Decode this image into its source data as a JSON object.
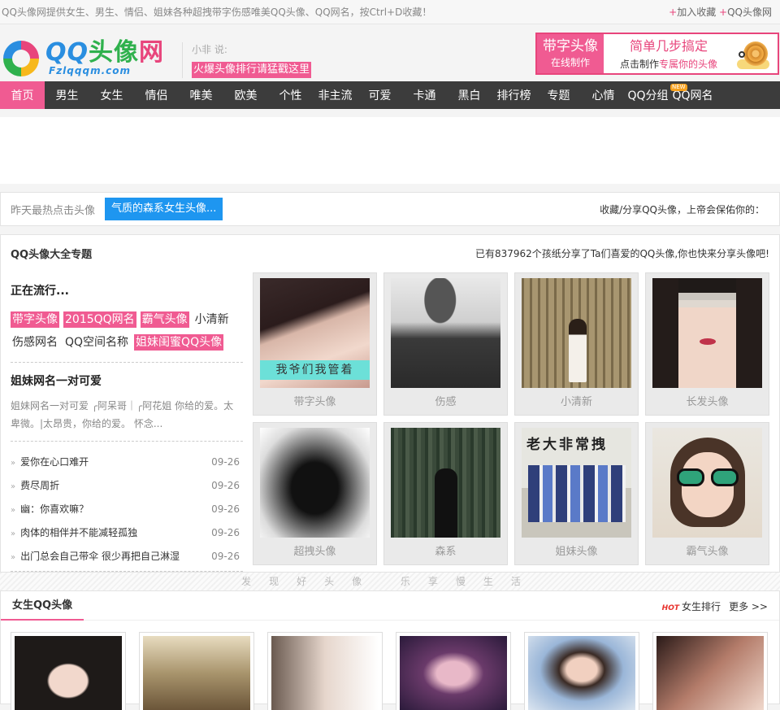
{
  "topbar": {
    "intro": "QQ头像网提供女生、男生、情侣、姐妹各种超拽带字伤感唯美QQ头像、QQ网名，按Ctrl+D收藏！",
    "plus1": "+",
    "fav": "加入收藏",
    "plus2": "+",
    "qqavatar": "QQ头像网"
  },
  "header": {
    "logo_part1": "QQ",
    "logo_part2": "头像",
    "logo_part3": "网",
    "logo_sub": "Fzlqqqm.com",
    "notice_who": "小非 说:",
    "notice_msg": "火爆头像排行请猛戳这里",
    "promo_l1": "带字头像",
    "promo_l2": "在线制作",
    "promo_r1": "简单几步搞定",
    "promo_r2a": "点击制作",
    "promo_r2b": "专属你的头像"
  },
  "nav": {
    "items": [
      "首页",
      "男生",
      "女生",
      "情侣",
      "唯美",
      "欧美",
      "个性",
      "非主流",
      "可爱",
      "卡通",
      "黑白",
      "排行榜",
      "专题",
      "心情",
      "QQ分组",
      "QQ网名"
    ],
    "badge": "NEW"
  },
  "hotbar": {
    "label": "昨天最热点击头像",
    "tag": "气质的森系女生头像...",
    "share": "收藏/分享QQ头像，上帝会保佑你的："
  },
  "topic": {
    "title": "QQ头像大全专题",
    "stat": "已有837962个孩纸分享了Ta们喜爱的QQ头像,你也快来分享头像吧!",
    "trending_title": "正在流行...",
    "tags": [
      {
        "text": "带字头像",
        "pink": true
      },
      {
        "text": "2015QQ网名",
        "pink": true
      },
      {
        "text": "霸气头像",
        "pink": true
      },
      {
        "text": "小清新",
        "pink": false
      },
      {
        "text": "伤感网名",
        "pink": false
      },
      {
        "text": "QQ空间名称",
        "pink": false
      },
      {
        "text": "姐妹闺蜜QQ头像",
        "pink": true
      }
    ],
    "feature_title": "姐妹网名一对可爱",
    "feature_desc": "姐妹网名一对可爱 ╭阿呆哥｜╭阿花姐 你给的爱。太卑微。|太昂贵，你给的爱。 怀念...",
    "news": [
      {
        "title": "爱你在心口难开",
        "date": "09-26"
      },
      {
        "title": "费尽周折",
        "date": "09-26"
      },
      {
        "title": "幽：你喜欢嘛？",
        "date": "09-26"
      },
      {
        "title": "肉体的相伴并不能减轻孤独",
        "date": "09-26"
      },
      {
        "title": "出门总会自己带伞 很少再把自己淋湿",
        "date": "09-26"
      }
    ],
    "cards": [
      "带字头像",
      "伤感",
      "小清新",
      "长发头像",
      "超拽头像",
      "森系",
      "姐妹头像",
      "霸气头像"
    ],
    "overlay_text": "我爷们我管着",
    "wall_text": "老大非常拽"
  },
  "slogan": "发现好头像 乐享慢生活",
  "girls": {
    "title": "女生QQ头像",
    "hot": "HOT",
    "rank": "女生排行",
    "more": "更多 >>"
  }
}
